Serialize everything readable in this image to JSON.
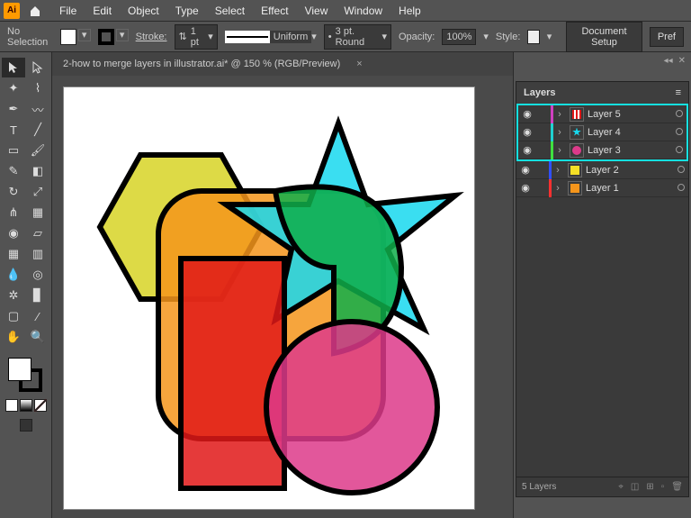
{
  "app": {
    "logo": "Ai"
  },
  "menu": [
    "File",
    "Edit",
    "Object",
    "Type",
    "Select",
    "Effect",
    "View",
    "Window",
    "Help"
  ],
  "opt": {
    "selection": "No Selection",
    "stroke_label": "Stroke:",
    "stroke_pt": "1 pt",
    "stroke_style": "Uniform",
    "brush": "3 pt. Round",
    "opacity_label": "Opacity:",
    "opacity": "100%",
    "style_label": "Style:",
    "doc_setup": "Document Setup",
    "pref": "Pref"
  },
  "tab": {
    "title": "2-how to merge layers in illustrator.ai* @ 150 % (RGB/Preview)",
    "close": "×"
  },
  "layers_panel": {
    "title": "Layers",
    "footer": "5 Layers",
    "rows": [
      {
        "name": "Layer 5",
        "color": "#d040c0",
        "selected": true,
        "thumb": "stripes"
      },
      {
        "name": "Layer 4",
        "color": "#20d0d0",
        "selected": true,
        "thumb": "star"
      },
      {
        "name": "Layer 3",
        "color": "#40e040",
        "selected": true,
        "thumb": "circle"
      },
      {
        "name": "Layer 2",
        "color": "#3050ff",
        "selected": false,
        "thumb": "square"
      },
      {
        "name": "Layer 1",
        "color": "#ff3030",
        "selected": false,
        "thumb": "plain"
      }
    ]
  }
}
